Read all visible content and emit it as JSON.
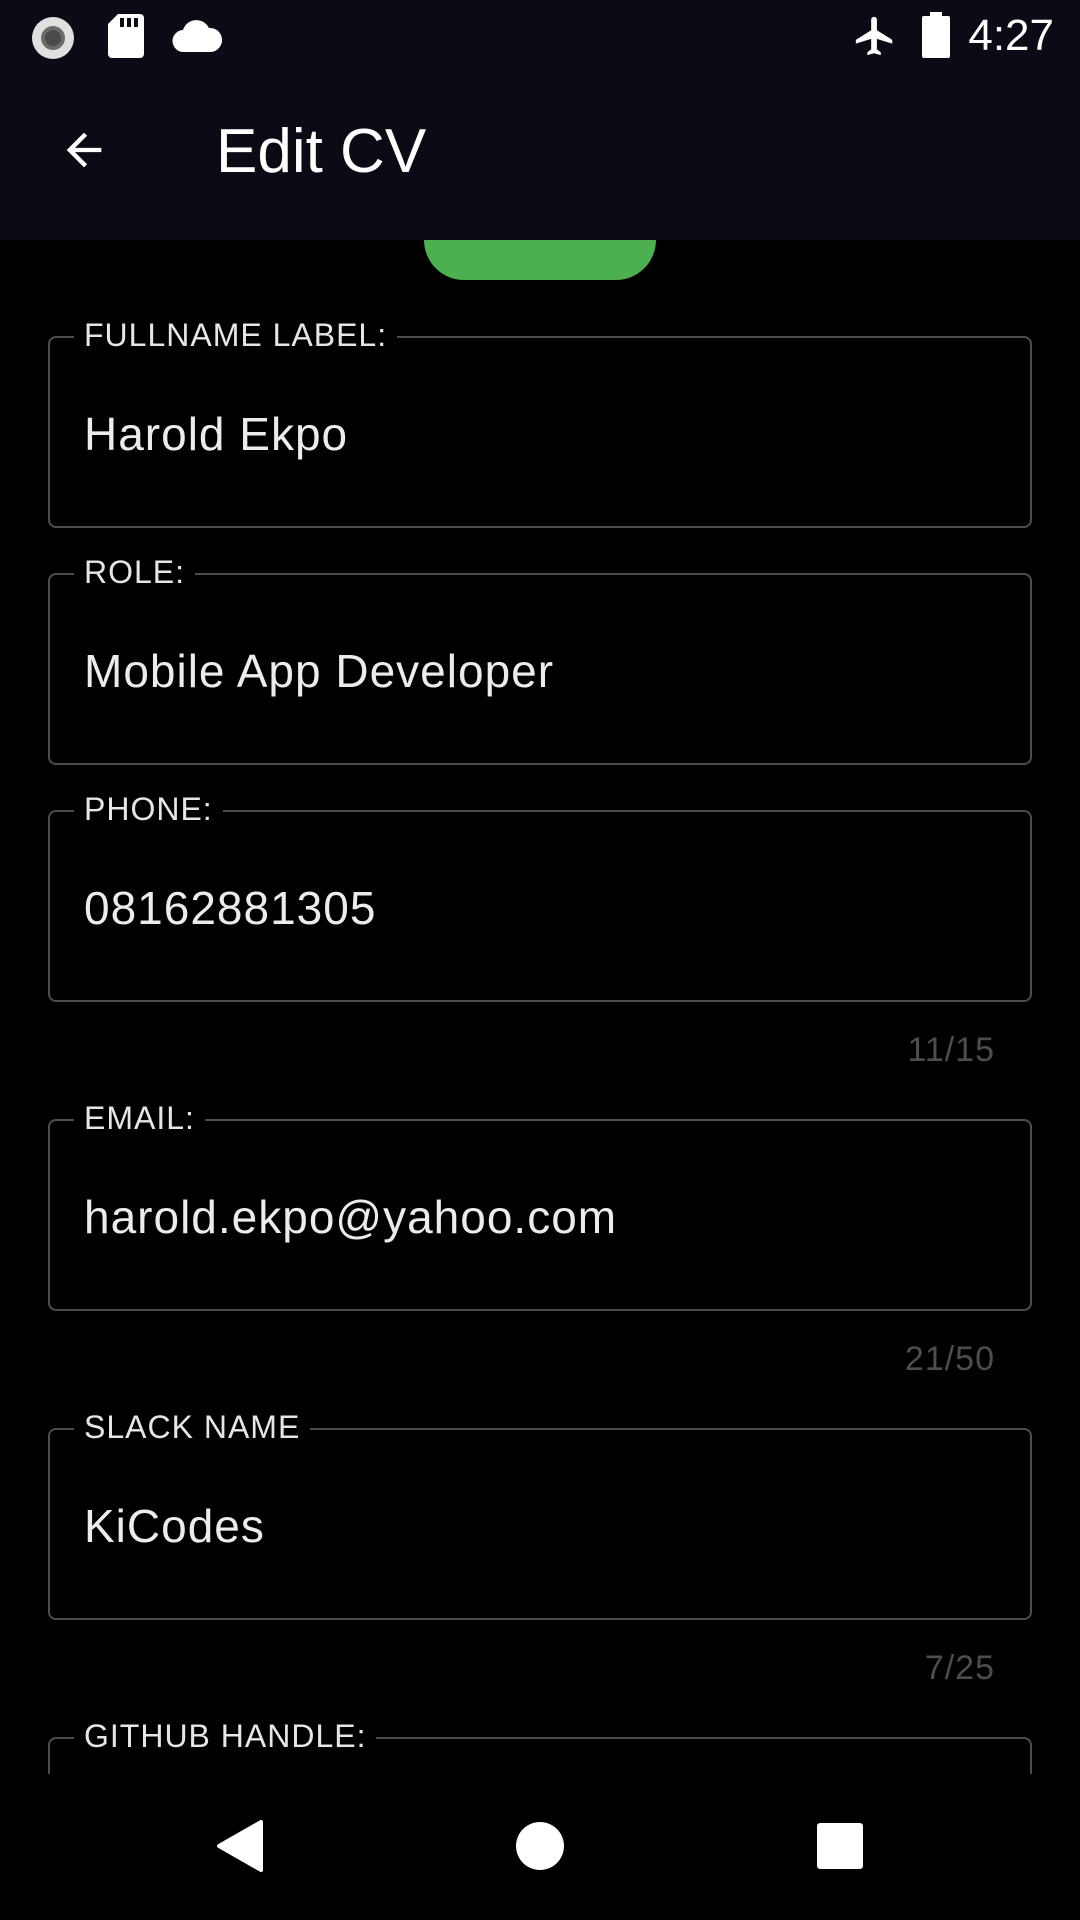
{
  "status_bar": {
    "time": "4:27",
    "icons": [
      "record-icon",
      "sd-card-icon",
      "cloud-icon",
      "airplane-mode-icon",
      "battery-icon"
    ]
  },
  "app_bar": {
    "title": "Edit CV",
    "back_icon": "arrow-back-icon"
  },
  "form": {
    "fields": [
      {
        "label": "FULLNAME LABEL:",
        "value": "Harold Ekpo",
        "counter": ""
      },
      {
        "label": "ROLE:",
        "value": "Mobile App Developer",
        "counter": ""
      },
      {
        "label": "PHONE:",
        "value": "08162881305",
        "counter": "11/15"
      },
      {
        "label": "EMAIL:",
        "value": "harold.ekpo@yahoo.com",
        "counter": "21/50"
      },
      {
        "label": "SLACK NAME",
        "value": "KiCodes",
        "counter": "7/25"
      },
      {
        "label": "GITHUB HANDLE:",
        "value": "",
        "counter": ""
      }
    ]
  },
  "nav_bar": {
    "icons": [
      "nav-back-icon",
      "nav-home-icon",
      "nav-recents-icon"
    ]
  },
  "colors": {
    "bar_background": "#0b0a15",
    "accent_green": "#4caf50",
    "field_border": "#4d4d4d",
    "counter_text": "#4d4d4d"
  }
}
